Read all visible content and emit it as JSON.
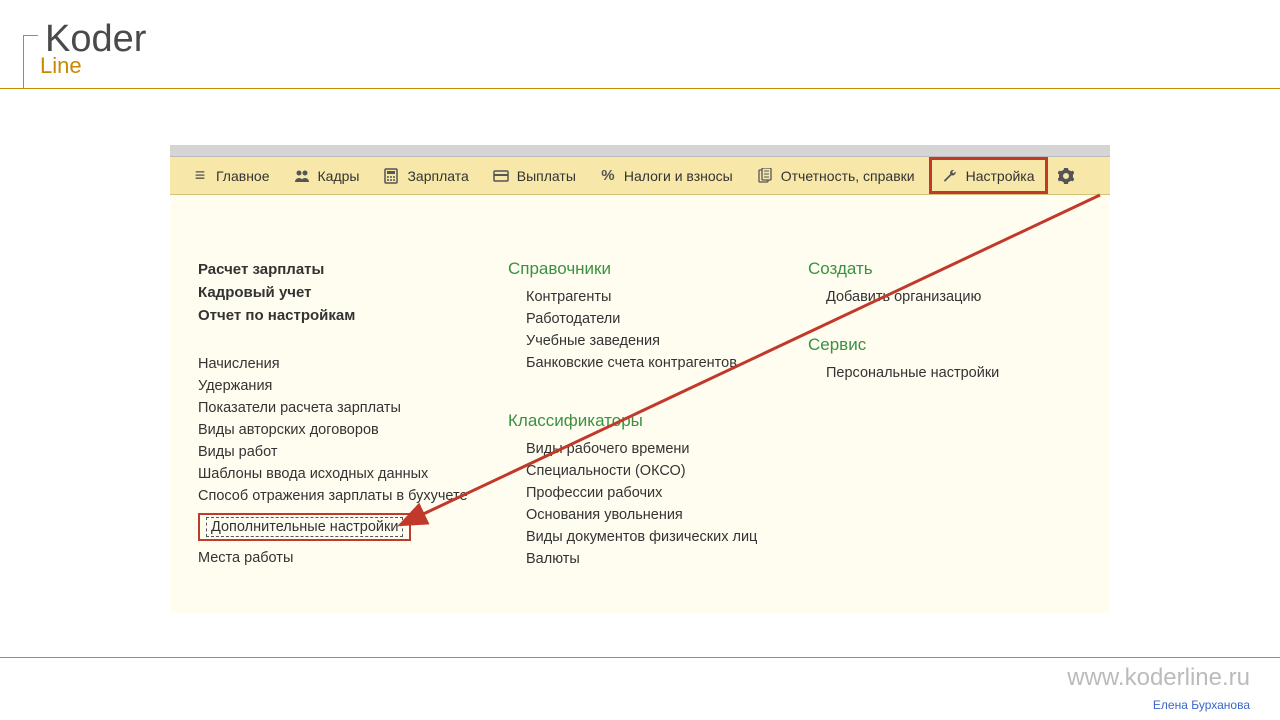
{
  "branding": {
    "logo_main": "Koder",
    "logo_sub": "Line",
    "footer_url": "www.koderline.ru",
    "footer_author": "Елена Бурханова"
  },
  "toolbar": {
    "items": [
      {
        "label": "Главное",
        "icon": "menu"
      },
      {
        "label": "Кадры",
        "icon": "people"
      },
      {
        "label": "Зарплата",
        "icon": "calc"
      },
      {
        "label": "Выплаты",
        "icon": "card"
      },
      {
        "label": "Налоги и взносы",
        "icon": "percent"
      },
      {
        "label": "Отчетность, справки",
        "icon": "report"
      },
      {
        "label": "Настройка",
        "icon": "wrench"
      }
    ]
  },
  "columns": {
    "col1": {
      "bold_items": [
        "Расчет зарплаты",
        "Кадровый учет",
        "Отчет по настройкам"
      ],
      "items": [
        "Начисления",
        "Удержания",
        "Показатели расчета зарплаты",
        "Виды авторских договоров",
        "Виды работ",
        "Шаблоны ввода исходных данных",
        "Способ отражения зарплаты в бухучете"
      ],
      "highlighted": "Дополнительные настройки",
      "after_highlight": [
        "Места работы"
      ]
    },
    "col2": {
      "sections": [
        {
          "header": "Справочники",
          "items": [
            "Контрагенты",
            "Работодатели",
            "Учебные заведения",
            "Банковские счета контрагентов"
          ]
        },
        {
          "header": "Классификаторы",
          "items": [
            "Виды рабочего времени",
            "Специальности (ОКСО)",
            "Профессии рабочих",
            "Основания увольнения",
            "Виды документов физических лиц",
            "Валюты"
          ]
        }
      ]
    },
    "col3": {
      "sections": [
        {
          "header": "Создать",
          "items": [
            "Добавить организацию"
          ]
        },
        {
          "header": "Сервис",
          "items": [
            "Персональные настройки"
          ]
        }
      ]
    }
  }
}
